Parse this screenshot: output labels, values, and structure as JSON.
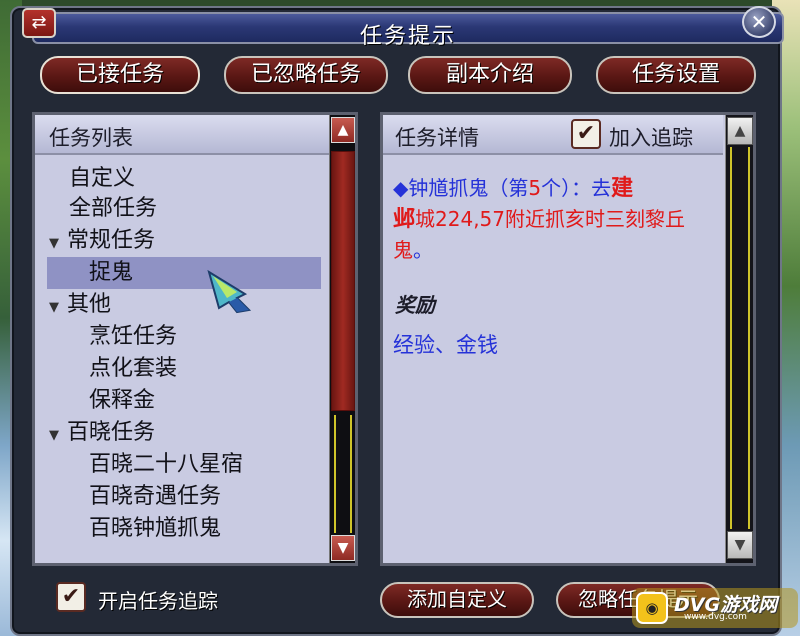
{
  "window": {
    "title": "任务提示"
  },
  "tabs": [
    {
      "label": "已接任务"
    },
    {
      "label": "已忽略任务"
    },
    {
      "label": "副本介绍"
    },
    {
      "label": "任务设置"
    }
  ],
  "task_list": {
    "header": "任务列表",
    "items": [
      {
        "label": "自定义",
        "level": 0,
        "expanded": null
      },
      {
        "label": "全部任务",
        "level": 0,
        "expanded": null
      },
      {
        "label": "常规任务",
        "level": 0,
        "expanded": true
      },
      {
        "label": "捉鬼",
        "level": 1,
        "selected": true
      },
      {
        "label": "其他",
        "level": 0,
        "expanded": true
      },
      {
        "label": "烹饪任务",
        "level": 1
      },
      {
        "label": "点化套装",
        "level": 1
      },
      {
        "label": "保释金",
        "level": 1
      },
      {
        "label": "百晓任务",
        "level": 0,
        "expanded": true
      },
      {
        "label": "百晓二十八星宿",
        "level": 1
      },
      {
        "label": "百晓奇遇任务",
        "level": 1
      },
      {
        "label": "百晓钟馗抓鬼",
        "level": 1
      }
    ]
  },
  "task_detail": {
    "header": "任务详情",
    "track_checkbox": {
      "label": "加入追踪",
      "checked": true
    },
    "description": {
      "bullet": "◆",
      "part1": "钟馗抓鬼（第",
      "count": "5",
      "part2": "个）：去",
      "place1": "建",
      "place2": "邺",
      "part3": "城224,57附近抓",
      "target": "亥时三刻黎丘鬼",
      "end": "。"
    },
    "reward_title": "奖励",
    "reward_text": "经验、金钱"
  },
  "bottom": {
    "enable_tracking": {
      "label": "开启任务追踪",
      "checked": true
    },
    "add_custom_button": "添加自定义",
    "ignore_button": "忽略任务提示"
  },
  "watermark": {
    "text": "DVG游戏网",
    "sub": "www.dvg.com"
  },
  "colors": {
    "panel_bg": "#c9cbe2",
    "button_red": "#5a1714",
    "selected_row": "#8f92c4",
    "text_blue": "#2532d8",
    "text_red": "#e01a1a"
  }
}
